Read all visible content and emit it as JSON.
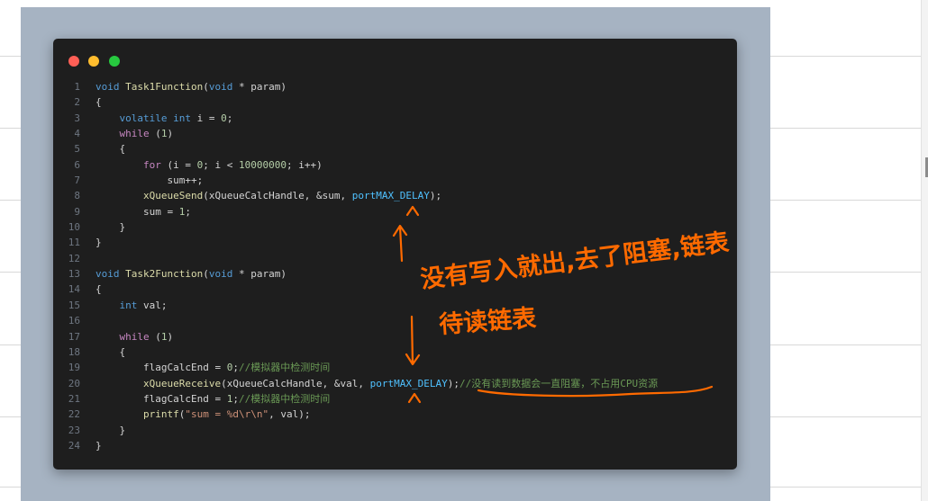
{
  "window": {
    "traffic_lights": [
      {
        "name": "close",
        "color": "#ff5f56"
      },
      {
        "name": "minimize",
        "color": "#ffbd2e"
      },
      {
        "name": "maximize",
        "color": "#27c93f"
      }
    ]
  },
  "code_lines": [
    {
      "n": "1",
      "tokens": [
        [
          "kw",
          "void"
        ],
        [
          "id",
          " "
        ],
        [
          "fn",
          "Task1Function"
        ],
        [
          "id",
          "("
        ],
        [
          "kw",
          "void"
        ],
        [
          "id",
          " * param)"
        ]
      ]
    },
    {
      "n": "2",
      "tokens": [
        [
          "id",
          "{"
        ]
      ]
    },
    {
      "n": "3",
      "tokens": [
        [
          "id",
          "    "
        ],
        [
          "kw",
          "volatile"
        ],
        [
          "id",
          " "
        ],
        [
          "kw",
          "int"
        ],
        [
          "id",
          " i = "
        ],
        [
          "num",
          "0"
        ],
        [
          "id",
          ";"
        ]
      ]
    },
    {
      "n": "4",
      "tokens": [
        [
          "id",
          "    "
        ],
        [
          "ctl",
          "while"
        ],
        [
          "id",
          " ("
        ],
        [
          "num",
          "1"
        ],
        [
          "id",
          ")"
        ]
      ]
    },
    {
      "n": "5",
      "tokens": [
        [
          "id",
          "    {"
        ]
      ]
    },
    {
      "n": "6",
      "tokens": [
        [
          "id",
          "        "
        ],
        [
          "ctl",
          "for"
        ],
        [
          "id",
          " (i = "
        ],
        [
          "num",
          "0"
        ],
        [
          "id",
          "; i < "
        ],
        [
          "num",
          "10000000"
        ],
        [
          "id",
          "; i++)"
        ]
      ]
    },
    {
      "n": "7",
      "tokens": [
        [
          "id",
          "            sum++;"
        ]
      ]
    },
    {
      "n": "8",
      "tokens": [
        [
          "id",
          "        "
        ],
        [
          "fn",
          "xQueueSend"
        ],
        [
          "id",
          "(xQueueCalcHandle, &sum, "
        ],
        [
          "mac",
          "portMAX_DELAY"
        ],
        [
          "id",
          ");"
        ]
      ]
    },
    {
      "n": "9",
      "tokens": [
        [
          "id",
          "        sum = "
        ],
        [
          "num",
          "1"
        ],
        [
          "id",
          ";"
        ]
      ]
    },
    {
      "n": "10",
      "tokens": [
        [
          "id",
          "    }"
        ]
      ]
    },
    {
      "n": "11",
      "tokens": [
        [
          "id",
          "}"
        ]
      ]
    },
    {
      "n": "12",
      "tokens": []
    },
    {
      "n": "13",
      "tokens": [
        [
          "kw",
          "void"
        ],
        [
          "id",
          " "
        ],
        [
          "fn",
          "Task2Function"
        ],
        [
          "id",
          "("
        ],
        [
          "kw",
          "void"
        ],
        [
          "id",
          " * param)"
        ]
      ]
    },
    {
      "n": "14",
      "tokens": [
        [
          "id",
          "{"
        ]
      ]
    },
    {
      "n": "15",
      "tokens": [
        [
          "id",
          "    "
        ],
        [
          "kw",
          "int"
        ],
        [
          "id",
          " val;"
        ]
      ]
    },
    {
      "n": "16",
      "tokens": []
    },
    {
      "n": "17",
      "tokens": [
        [
          "id",
          "    "
        ],
        [
          "ctl",
          "while"
        ],
        [
          "id",
          " ("
        ],
        [
          "num",
          "1"
        ],
        [
          "id",
          ")"
        ]
      ]
    },
    {
      "n": "18",
      "tokens": [
        [
          "id",
          "    {"
        ]
      ]
    },
    {
      "n": "19",
      "tokens": [
        [
          "id",
          "        flagCalcEnd = "
        ],
        [
          "num",
          "0"
        ],
        [
          "id",
          ";"
        ],
        [
          "cmt",
          "//模拟器中检测时间"
        ]
      ]
    },
    {
      "n": "20",
      "tokens": [
        [
          "id",
          "        "
        ],
        [
          "fn",
          "xQueueReceive"
        ],
        [
          "id",
          "(xQueueCalcHandle, &val, "
        ],
        [
          "mac",
          "portMAX_DELAY"
        ],
        [
          "id",
          ");"
        ],
        [
          "cmt",
          "//没有读到数据会一直阻塞，不占用CPU资源"
        ]
      ]
    },
    {
      "n": "21",
      "tokens": [
        [
          "id",
          "        flagCalcEnd = "
        ],
        [
          "num",
          "1"
        ],
        [
          "id",
          ";"
        ],
        [
          "cmt",
          "//模拟器中检测时间"
        ]
      ]
    },
    {
      "n": "22",
      "tokens": [
        [
          "id",
          "        "
        ],
        [
          "fn",
          "printf"
        ],
        [
          "id",
          "("
        ],
        [
          "str",
          "\"sum = %d\\r\\n\""
        ],
        [
          "id",
          ", val);"
        ]
      ]
    },
    {
      "n": "23",
      "tokens": [
        [
          "id",
          "    }"
        ]
      ]
    },
    {
      "n": "24",
      "tokens": [
        [
          "id",
          "}"
        ]
      ]
    }
  ],
  "annotation": {
    "line1": "没有写入就出,去了阻塞,链表",
    "line2": "待读链表",
    "color": "#ff6a00"
  }
}
